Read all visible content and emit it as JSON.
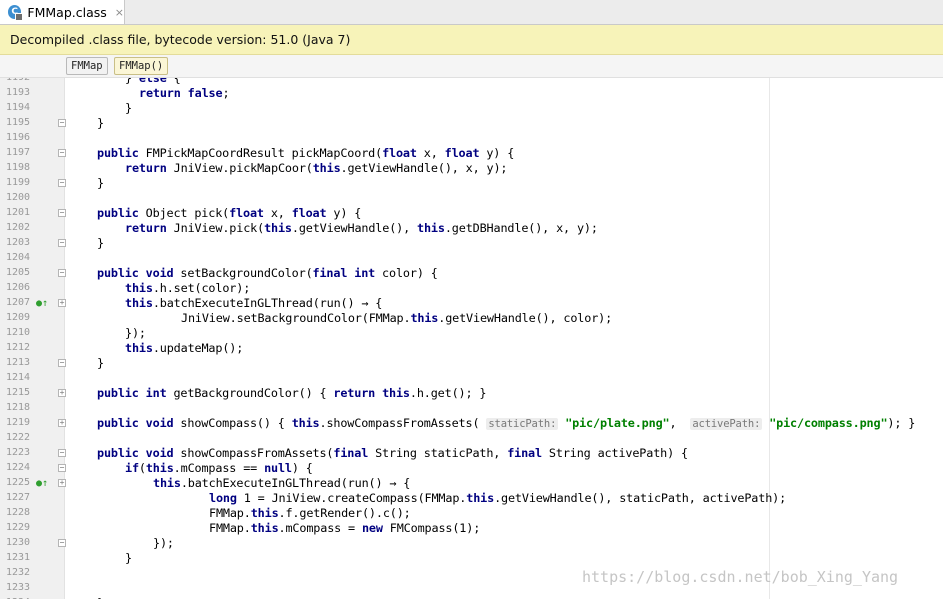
{
  "tab": {
    "title": "FMMap.class",
    "icon": "class-file-icon",
    "close": "×"
  },
  "banner": {
    "text": "Decompiled .class file, bytecode version: 51.0 (Java 7)"
  },
  "breadcrumbs": [
    "FMMap",
    "FMMap()"
  ],
  "lines": [
    {
      "n": "1192",
      "code": "} else {"
    },
    {
      "n": "1193",
      "code": "return false;"
    },
    {
      "n": "1194",
      "code": "}"
    },
    {
      "n": "1195",
      "code": "}"
    },
    {
      "n": "1196",
      "code": ""
    },
    {
      "n": "1197",
      "code": "public FMPickMapCoordResult pickMapCoord(float x, float y) {"
    },
    {
      "n": "1198",
      "code": "return JniView.pickMapCoor(this.getViewHandle(), x, y);"
    },
    {
      "n": "1199",
      "code": "}"
    },
    {
      "n": "1200",
      "code": ""
    },
    {
      "n": "1201",
      "code": "public Object pick(float x, float y) {"
    },
    {
      "n": "1202",
      "code": "return JniView.pick(this.getViewHandle(), this.getDBHandle(), x, y);"
    },
    {
      "n": "1203",
      "code": "}"
    },
    {
      "n": "1204",
      "code": ""
    },
    {
      "n": "1205",
      "code": "public void setBackgroundColor(final int color) {"
    },
    {
      "n": "1206",
      "code": "this.h.set(color);"
    },
    {
      "n": "1207",
      "code": "this.batchExecuteInGLThread(run() → {"
    },
    {
      "n": "1209",
      "code": "JniView.setBackgroundColor(FMMap.this.getViewHandle(), color);"
    },
    {
      "n": "1210",
      "code": "});"
    },
    {
      "n": "1212",
      "code": "this.updateMap();"
    },
    {
      "n": "1213",
      "code": "}"
    },
    {
      "n": "1214",
      "code": ""
    },
    {
      "n": "1215",
      "code": "public int getBackgroundColor() { return this.h.get(); }"
    },
    {
      "n": "1218",
      "code": ""
    },
    {
      "n": "1219",
      "code": "public void showCompass() { this.showCompassFromAssets( staticPath: \"pic/plate.png\",  activePath: \"pic/compass.png\"); }"
    },
    {
      "n": "1222",
      "code": ""
    },
    {
      "n": "1223",
      "code": "public void showCompassFromAssets(final String staticPath, final String activePath) {"
    },
    {
      "n": "1224",
      "code": "if(this.mCompass == null) {"
    },
    {
      "n": "1225",
      "code": "this.batchExecuteInGLThread(run() → {"
    },
    {
      "n": "1227",
      "code": "long var1 = JniView.createCompass(FMMap.this.getViewHandle(), staticPath, activePath);"
    },
    {
      "n": "1228",
      "code": "FMMap.this.f.getRender().c();"
    },
    {
      "n": "1229",
      "code": "FMMap.this.mCompass = new FMCompass(var1);"
    },
    {
      "n": "1230",
      "code": "});"
    },
    {
      "n": "1231",
      "code": "}"
    },
    {
      "n": "1232",
      "code": ""
    },
    {
      "n": "1233",
      "code": ""
    },
    {
      "n": "1234",
      "code": "}"
    }
  ],
  "watermark": "https://blog.csdn.net/bob_Xing_Yang",
  "colors": {
    "keyword": "#000080",
    "string": "#008000",
    "banner": "#f7f3b9"
  }
}
